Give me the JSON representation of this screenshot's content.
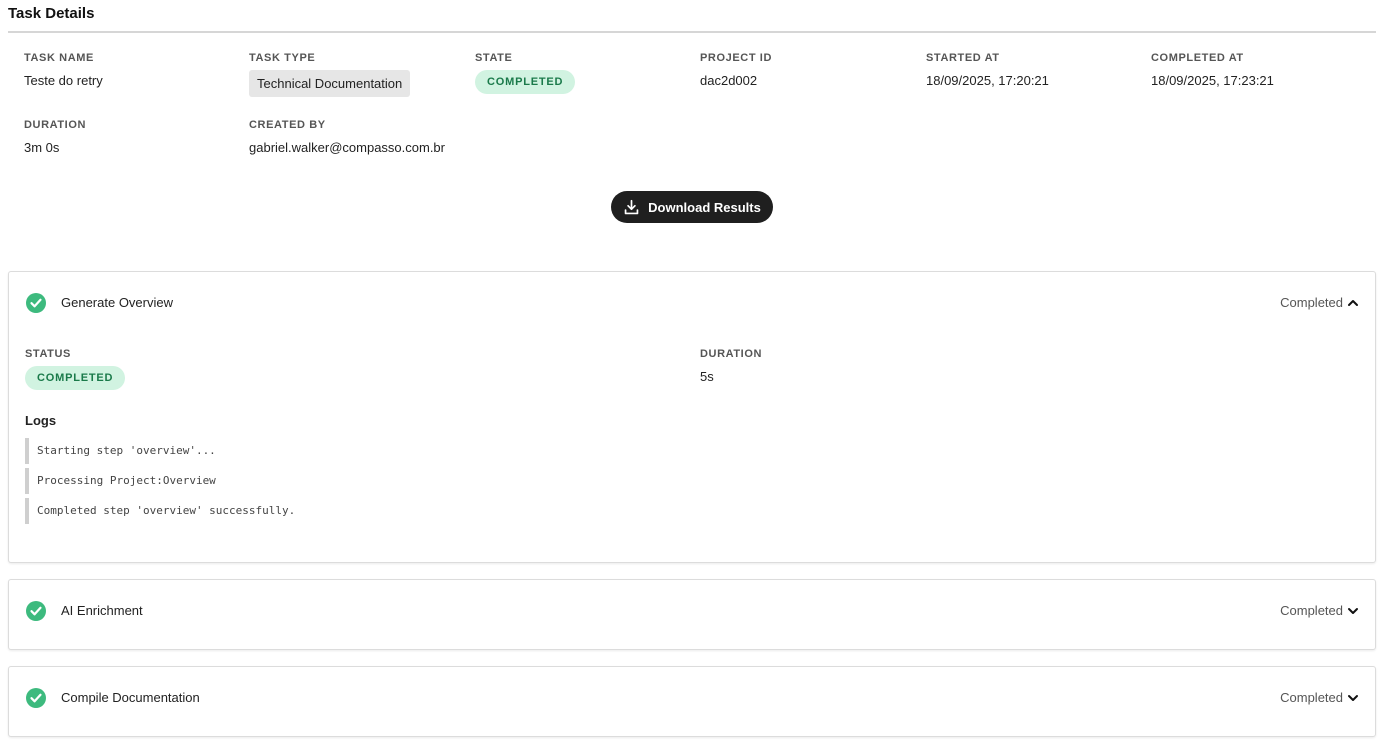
{
  "page": {
    "title": "Task Details"
  },
  "task": {
    "name_label": "TASK NAME",
    "name": "Teste do retry",
    "type_label": "TASK TYPE",
    "type": "Technical Documentation",
    "state_label": "STATE",
    "state": "COMPLETED",
    "project_label": "PROJECT ID",
    "project_id": "dac2d002",
    "started_label": "STARTED AT",
    "started_at": "18/09/2025, 17:20:21",
    "completed_label": "COMPLETED AT",
    "completed_at": "18/09/2025, 17:23:21",
    "duration_label": "DURATION",
    "duration": "3m 0s",
    "created_label": "CREATED BY",
    "created_by": "gabriel.walker@compasso.com.br"
  },
  "actions": {
    "download_label": "Download Results"
  },
  "steps": [
    {
      "name": "Generate Overview",
      "status": "Completed",
      "expanded": true,
      "status_label": "STATUS",
      "status_badge": "COMPLETED",
      "duration_label": "DURATION",
      "duration": "5s",
      "logs_title": "Logs",
      "logs": [
        "Starting step 'overview'...",
        "Processing Project:Overview",
        "Completed step 'overview' successfully."
      ]
    },
    {
      "name": "AI Enrichment",
      "status": "Completed",
      "expanded": false
    },
    {
      "name": "Compile Documentation",
      "status": "Completed",
      "expanded": false
    }
  ],
  "colors": {
    "success": "#3dba7e",
    "badge_bg": "#d1f3e1",
    "badge_text": "#1a7a4a",
    "button_bg": "#1f1f1f"
  },
  "icons": {
    "download": "download-icon",
    "check": "check-circle-icon",
    "chevron_up": "chevron-up-icon",
    "chevron_down": "chevron-down-icon"
  }
}
